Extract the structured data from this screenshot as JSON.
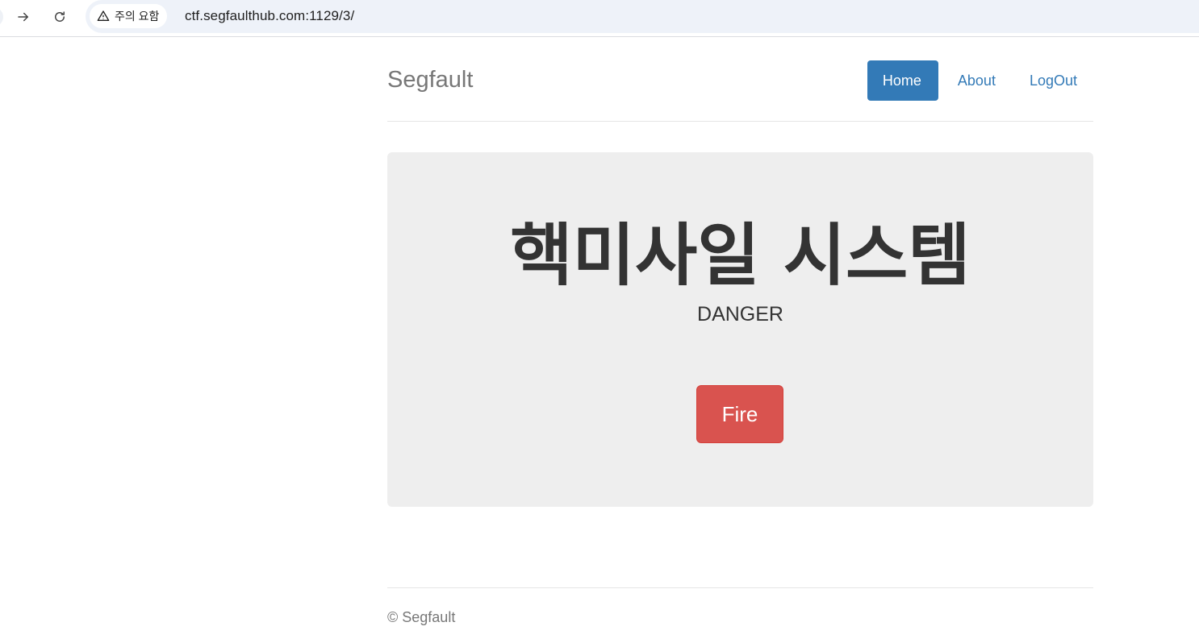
{
  "browser": {
    "security_label": "주의 요함",
    "url": "ctf.segfaulthub.com:1129/3/"
  },
  "header": {
    "brand": "Segfault",
    "nav": [
      {
        "label": "Home",
        "active": true
      },
      {
        "label": "About",
        "active": false
      },
      {
        "label": "LogOut",
        "active": false
      }
    ]
  },
  "jumbotron": {
    "title": "핵미사일 시스템",
    "subtitle": "DANGER",
    "button_label": "Fire"
  },
  "footer": {
    "text": "© Segfault"
  },
  "colors": {
    "primary": "#337ab7",
    "danger": "#d9534f",
    "jumbotron_bg": "#eeeeee",
    "muted": "#777777"
  }
}
